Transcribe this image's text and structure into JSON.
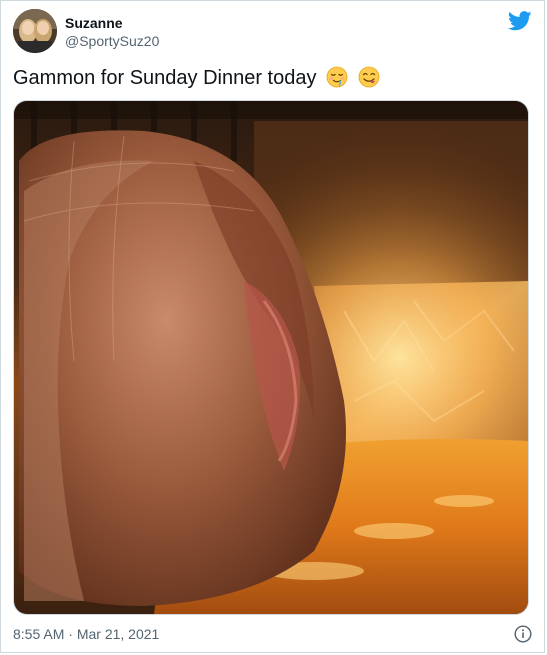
{
  "author": {
    "display_name": "Suzanne",
    "handle": "@SportySuz20"
  },
  "tweet": {
    "text": "Gammon for Sunday Dinner today",
    "emojis": [
      "relieved-drooling-face",
      "face-savoring-food"
    ]
  },
  "meta": {
    "time": "8:55 AM",
    "separator": "·",
    "date": "Mar 21, 2021"
  },
  "colors": {
    "twitter_blue": "#1d9bf0",
    "secondary_text": "#536471",
    "border": "#cfd9de"
  },
  "icons": {
    "brand": "twitter-bird-icon",
    "info": "info-circle-icon"
  }
}
